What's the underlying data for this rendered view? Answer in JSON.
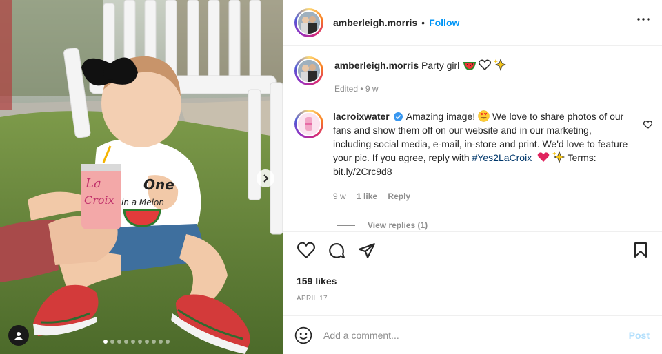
{
  "post": {
    "header": {
      "username": "amberleigh.morris",
      "separator": "•",
      "follow_label": "Follow"
    },
    "caption": {
      "username": "amberleigh.morris",
      "text": "Party girl",
      "emojis": [
        "watermelon",
        "white-heart",
        "sparkles"
      ],
      "meta": "Edited • 9 w"
    },
    "comment": {
      "username": "lacroixwater",
      "verified": true,
      "text_1": "Amazing image! ",
      "text_2": " We love to share photos of our fans and show them off on our website and in our marketing, including social media, e-mail, in-store and print. We'd love to feature your pic. If you agree, reply with ",
      "hashtag": "#Yes2LaCroix",
      "text_3": " Terms: bit.ly/2Crc9d8",
      "age": "9 w",
      "likes": "1 like",
      "reply_label": "Reply",
      "view_replies": "View replies (1)"
    },
    "likes": "159 likes",
    "date": "APRIL 17",
    "add_comment": {
      "placeholder": "Add a comment...",
      "post_label": "Post"
    },
    "media": {
      "can_text_line1": "La",
      "can_text_line2": "Croix",
      "shirt_text_line1": "One",
      "shirt_text_line2": "in a Melon",
      "carousel_count": 10,
      "carousel_active": 0
    }
  },
  "colors": {
    "link_blue": "#0095f6",
    "post_disabled": "#b2dffc",
    "hashtag": "#00376b",
    "muted": "#8e8e8e"
  }
}
